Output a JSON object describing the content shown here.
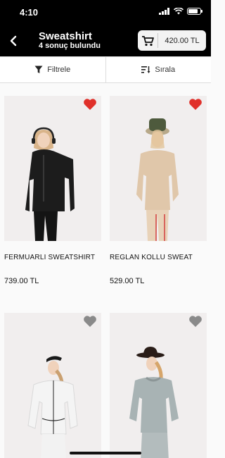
{
  "status_bar": {
    "time": "4:10"
  },
  "header": {
    "title": "Sweatshirt",
    "subtitle": "4 sonuç bulundu",
    "cart_total": "420.00 TL"
  },
  "toolbar": {
    "filter_label": "Filtrele",
    "sort_label": "Sırala"
  },
  "colors": {
    "accent_heart_active": "#e0302a",
    "heart_inactive": "#8a8a8a",
    "header_bg": "#000000"
  },
  "products": [
    {
      "name": "FERMUARLI SWEATSHIRT",
      "price": "739.00 TL",
      "favorite": true
    },
    {
      "name": "REGLAN KOLLU SWEAT",
      "price": "529.00 TL",
      "favorite": true
    },
    {
      "name": "",
      "price": "",
      "favorite": false
    },
    {
      "name": "",
      "price": "",
      "favorite": false
    }
  ]
}
